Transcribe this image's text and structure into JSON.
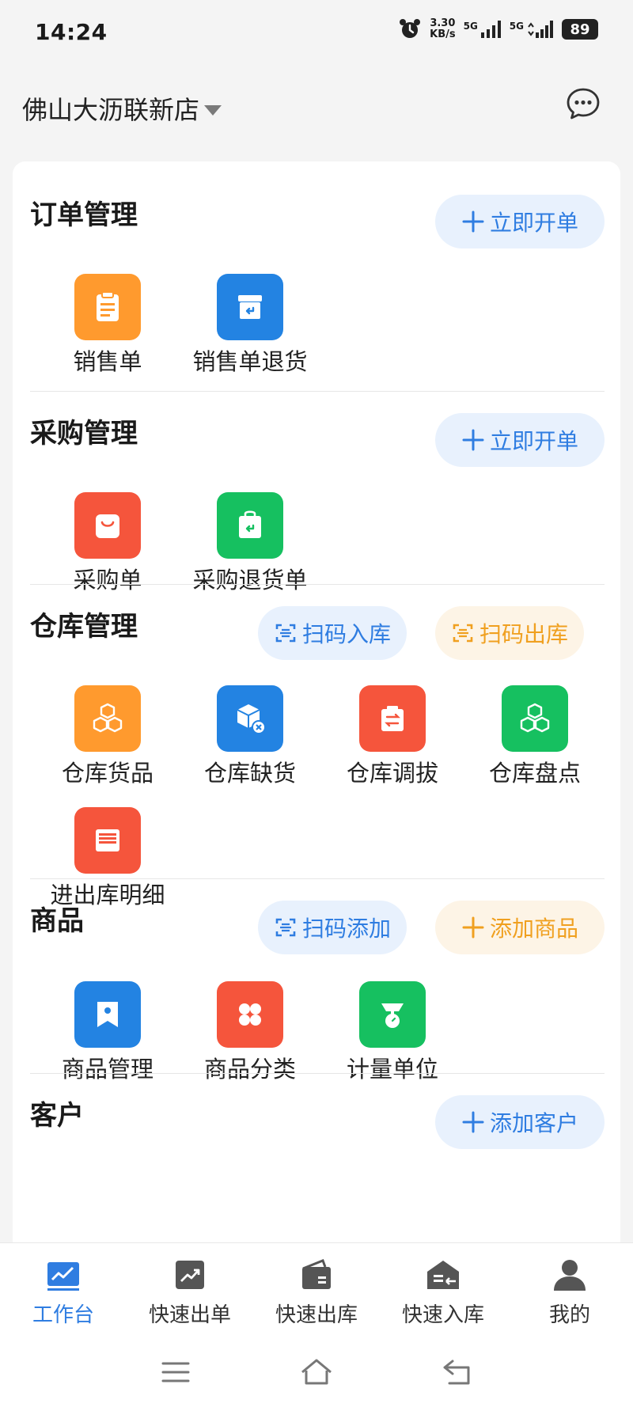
{
  "status_bar": {
    "time": "14:24",
    "net_speed_value": "3.30",
    "net_speed_unit": "KB/s",
    "sig1_label": "5G",
    "sig2_label": "5G",
    "battery": "89"
  },
  "header": {
    "store_name": "佛山大沥联新店"
  },
  "sections": {
    "order": {
      "title": "订单管理",
      "action": "立即开单",
      "items": [
        "销售单",
        "销售单退货"
      ]
    },
    "purchase": {
      "title": "采购管理",
      "action": "立即开单",
      "items": [
        "采购单",
        "采购退货单"
      ]
    },
    "warehouse": {
      "title": "仓库管理",
      "action_scan_in": "扫码入库",
      "action_scan_out": "扫码出库",
      "items": [
        "仓库货品",
        "仓库缺货",
        "仓库调拔",
        "仓库盘点",
        "进出库明细"
      ]
    },
    "goods": {
      "title": "商品",
      "action_scan_add": "扫码添加",
      "action_add": "添加商品",
      "items": [
        "商品管理",
        "商品分类",
        "计量单位"
      ]
    },
    "customer": {
      "title": "客户",
      "action": "添加客户"
    }
  },
  "bottom_nav": [
    "工作台",
    "快速出单",
    "快速出库",
    "快速入库",
    "我的"
  ],
  "colors": {
    "accent_blue": "#2f7de1",
    "accent_orange": "#f0a020",
    "tile_orange": "#ff9a2e",
    "tile_blue": "#2383e2",
    "tile_red": "#f5553c",
    "tile_green": "#16c060"
  },
  "icons": {
    "sales-order": "clipboard-icon",
    "sales-return": "return-box-icon",
    "purchase-order": "shopping-bag-icon",
    "purchase-return": "return-bag-icon",
    "warehouse-goods": "boxes-icon",
    "warehouse-shortage": "box-x-icon",
    "warehouse-transfer": "transfer-icon",
    "warehouse-stocktake": "boxes-icon",
    "inout-detail": "printer-icon",
    "goods-manage": "bookmark-icon",
    "goods-category": "grid-icon",
    "measure-unit": "scale-icon"
  }
}
